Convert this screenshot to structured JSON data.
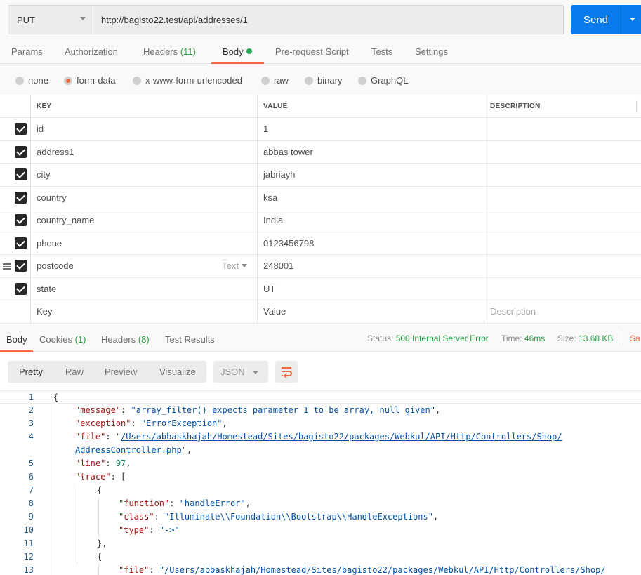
{
  "request": {
    "method": "PUT",
    "url": "http://bagisto22.test/api/addresses/1",
    "send_label": "Send"
  },
  "request_tabs": [
    {
      "label": "Params"
    },
    {
      "label": "Authorization"
    },
    {
      "label": "Headers",
      "count": "(11)"
    },
    {
      "label": "Body",
      "active": true,
      "indicator": "green-dot"
    },
    {
      "label": "Pre-request Script"
    },
    {
      "label": "Tests"
    },
    {
      "label": "Settings"
    }
  ],
  "body_types": [
    {
      "label": "none"
    },
    {
      "label": "form-data",
      "selected": true
    },
    {
      "label": "x-www-form-urlencoded"
    },
    {
      "label": "raw"
    },
    {
      "label": "binary"
    },
    {
      "label": "GraphQL"
    }
  ],
  "table": {
    "headers": {
      "key": "KEY",
      "value": "VALUE",
      "description": "DESCRIPTION"
    },
    "rows": [
      {
        "key": "id",
        "value": "1",
        "checked": true
      },
      {
        "key": "address1",
        "value": "abbas tower",
        "checked": true
      },
      {
        "key": "city",
        "value": "jabriayh",
        "checked": true
      },
      {
        "key": "country",
        "value": "ksa",
        "checked": true
      },
      {
        "key": "country_name",
        "value": "India",
        "checked": true
      },
      {
        "key": "phone",
        "value": "0123456798",
        "checked": true
      },
      {
        "key": "postcode",
        "value": "248001",
        "checked": true,
        "type": "Text"
      },
      {
        "key": "state",
        "value": "UT",
        "checked": true
      }
    ],
    "placeholders": {
      "key": "Key",
      "value": "Value",
      "description": "Description"
    }
  },
  "response": {
    "tabs": [
      {
        "label": "Body",
        "active": true
      },
      {
        "label": "Cookies",
        "count": "(1)"
      },
      {
        "label": "Headers",
        "count": "(8)"
      },
      {
        "label": "Test Results"
      }
    ],
    "status_label": "Status:",
    "status_value": "500 Internal Server Error",
    "time_label": "Time:",
    "time_value": "46ms",
    "size_label": "Size:",
    "size_value": "13.68 KB",
    "save_label": "Sa",
    "view_modes": [
      "Pretty",
      "Raw",
      "Preview",
      "Visualize"
    ],
    "active_view": "Pretty",
    "format": "JSON",
    "lines": [
      {
        "n": "1",
        "t": "{"
      },
      {
        "n": "2",
        "key": "\"message\"",
        "val": "\"array_filter() expects parameter 1 to be array, null given\"",
        "tail": ","
      },
      {
        "n": "3",
        "key": "\"exception\"",
        "val": "\"ErrorException\"",
        "tail": ","
      },
      {
        "n": "4",
        "key": "\"file\"",
        "val": "\"/Users/abbaskhajah/Homestead/Sites/bagisto22/packages/Webkul/API/Http/Controllers/Shop/",
        "link": true
      },
      {
        "n": "",
        "cont": "AddressController.php",
        "tail": "\","
      },
      {
        "n": "5",
        "key": "\"line\"",
        "num": "97",
        "tail": ","
      },
      {
        "n": "6",
        "key": "\"trace\"",
        "t2": "["
      },
      {
        "n": "7",
        "t": "{"
      },
      {
        "n": "8",
        "key": "\"function\"",
        "val": "\"handleError\"",
        "tail": ","
      },
      {
        "n": "9",
        "key": "\"class\"",
        "val": "\"Illuminate\\\\Foundation\\\\Bootstrap\\\\HandleExceptions\"",
        "tail": ","
      },
      {
        "n": "10",
        "key": "\"type\"",
        "val": "\"->\""
      },
      {
        "n": "11",
        "t": "},"
      },
      {
        "n": "12",
        "t": "{"
      },
      {
        "n": "13",
        "key": "\"file\"",
        "val": "\"/Users/abbaskhajah/Homestead/Sites/bagisto22/packages/Webkul/API/Http/Controllers/Shop/"
      }
    ]
  },
  "colors": {
    "accent": "#f26b3a",
    "send": "#097bed",
    "success": "#30a04a",
    "json_key": "#a31515",
    "json_string": "#0451a5",
    "json_number": "#098658"
  }
}
